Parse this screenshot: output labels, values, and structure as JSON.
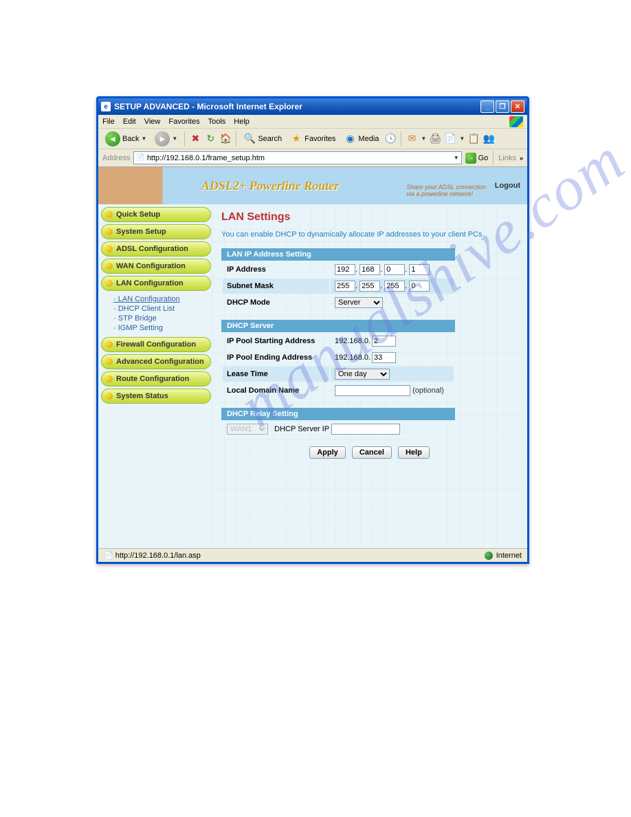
{
  "window": {
    "title": "SETUP ADVANCED - Microsoft Internet Explorer"
  },
  "menu": {
    "file": "File",
    "edit": "Edit",
    "view": "View",
    "favorites": "Favorites",
    "tools": "Tools",
    "help": "Help"
  },
  "toolbar": {
    "back": "Back",
    "search": "Search",
    "favorites": "Favorites",
    "media": "Media"
  },
  "address": {
    "label": "Address",
    "url": "http://192.168.0.1/frame_setup.htm",
    "go": "Go",
    "links": "Links"
  },
  "banner": {
    "title": "ADSL2+ Powerline Router",
    "tagline1": "Share your ADSL connection",
    "tagline2": "via a powerline network!",
    "logout": "Logout"
  },
  "nav": {
    "quick_setup": "Quick Setup",
    "system_setup": "System Setup",
    "adsl_config": "ADSL Configuration",
    "wan_config": "WAN Configuration",
    "lan_config": "LAN Configuration",
    "firewall_config": "Firewall Configuration",
    "advanced_config": "Advanced Configuration",
    "route_config": "Route Configuration",
    "system_status": "System Status",
    "sub": {
      "lan_configuration": "LAN Configuration",
      "dhcp_client_list": "DHCP Client List",
      "stp_bridge": "STP Bridge",
      "igmp_setting": "IGMP Setting"
    }
  },
  "page": {
    "title": "LAN Settings",
    "description": "You can enable DHCP to dynamically allocate IP addresses to your client PCs."
  },
  "lan_ip": {
    "header": "LAN IP Address Setting",
    "ip_label": "IP Address",
    "ip": [
      "192",
      "168",
      "0",
      "1"
    ],
    "mask_label": "Subnet Mask",
    "mask": [
      "255",
      "255",
      "255",
      "0"
    ],
    "dhcp_mode_label": "DHCP Mode",
    "dhcp_mode": "Server"
  },
  "dhcp_server": {
    "header": "DHCP Server",
    "pool_start_label": "IP Pool Starting Address",
    "prefix": "192.168.0.",
    "pool_start": "2",
    "pool_end_label": "IP Pool Ending Address",
    "pool_end": "33",
    "lease_label": "Lease Time",
    "lease": "One day",
    "domain_label": "Local Domain Name",
    "domain": "",
    "optional": "(optional)"
  },
  "dhcp_relay": {
    "header": "DHCP Relay Setting",
    "interface": "WAN1",
    "server_ip_label": "DHCP Server IP",
    "server_ip": ""
  },
  "buttons": {
    "apply": "Apply",
    "cancel": "Cancel",
    "help": "Help"
  },
  "status": {
    "url": "http://192.168.0.1/lan.asp",
    "zone": "Internet"
  },
  "watermark": "manualshive.com",
  "chevron": "»"
}
